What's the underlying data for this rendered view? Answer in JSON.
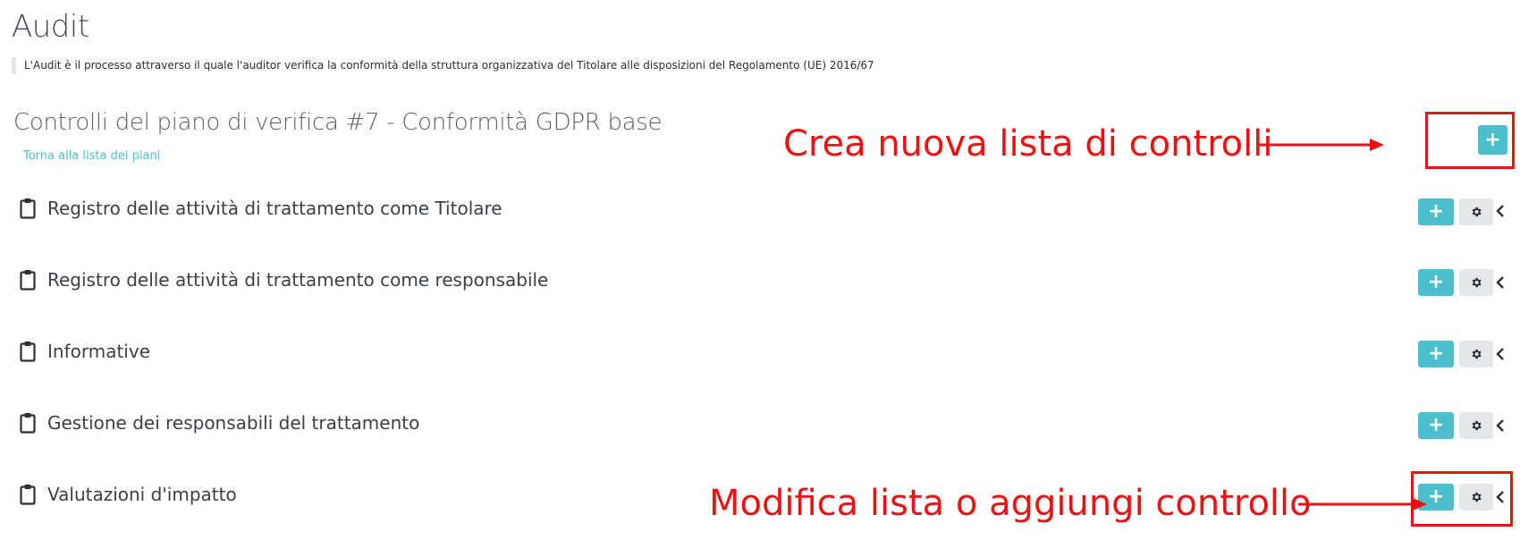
{
  "page": {
    "title": "Audit",
    "intro": "L'Audit è il processo attraverso il quale l'auditor verifica la conformità della struttura organizzativa del Titolare alle disposizioni del Regolamento (UE) 2016/67"
  },
  "plan": {
    "title": "Controlli del piano di verifica #7 - Conformità GDPR base",
    "back_link": "Torna alla lista dei piani",
    "add_button_label": "+"
  },
  "checklists": [
    {
      "label": "Registro delle attività di trattamento come Titolare",
      "add_label": "+"
    },
    {
      "label": "Registro delle attività di trattamento come responsabile",
      "add_label": "+"
    },
    {
      "label": "Informative",
      "add_label": "+"
    },
    {
      "label": "Gestione dei responsabili del trattamento",
      "add_label": "+"
    },
    {
      "label": "Valutazioni d'impatto",
      "add_label": "+"
    }
  ],
  "annotations": {
    "create_list": "Crea nuova lista di controlli",
    "edit_list": "Modifica lista o aggiungi controllo",
    "color": "#ee1111"
  },
  "colors": {
    "accent": "#4bbfcc",
    "secondary_button": "#e4e7ea",
    "text": "#3a3f48"
  },
  "icons": {
    "list_icon": "clipboard-icon",
    "settings_icon": "gear-icon",
    "expand_icon": "chevron-left-icon",
    "add_icon": "plus-icon"
  }
}
